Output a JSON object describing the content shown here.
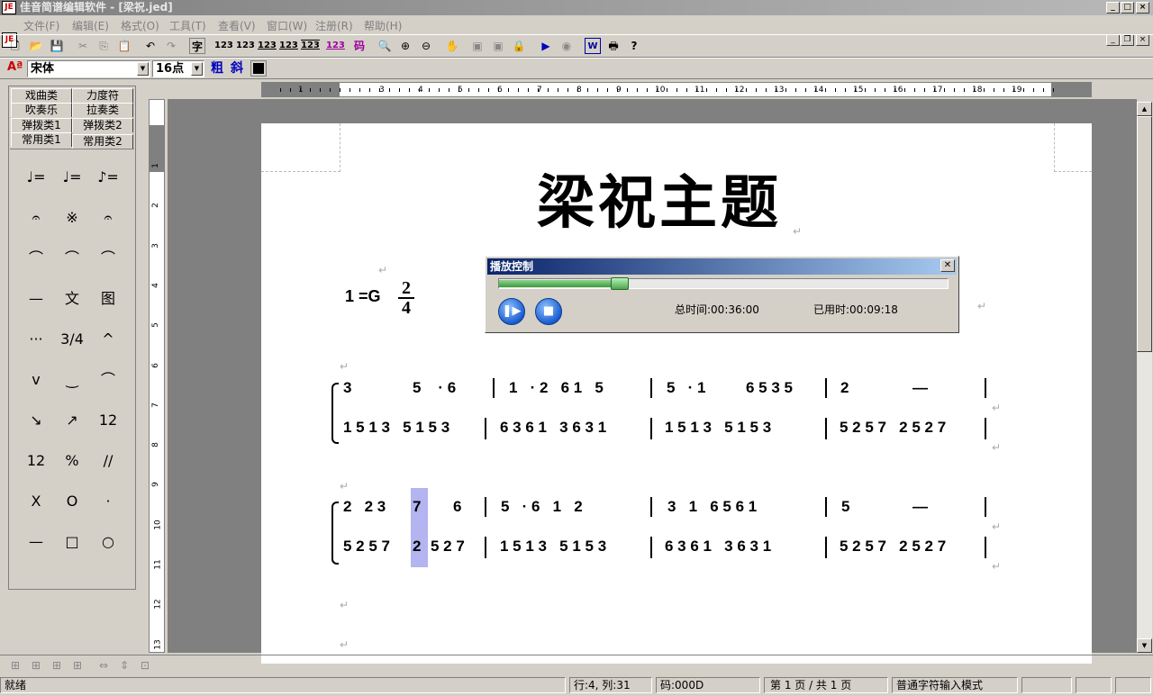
{
  "window": {
    "title": "佳音简谱编辑软件 - [梁祝.jed]",
    "app_logo": "JE"
  },
  "menu": [
    "文件(F)",
    "编辑(E)",
    "格式(O)",
    "工具(T)",
    "查看(V)",
    "窗口(W)",
    "注册(R)",
    "帮助(H)"
  ],
  "toolbar": {
    "text_label": "字",
    "num_labels": [
      "123",
      "123",
      "123",
      "123",
      "123",
      "123"
    ],
    "code_label": "码",
    "help_label": "?"
  },
  "format": {
    "font_value": "宋体",
    "size_value": "16点",
    "bold_label": "粗",
    "italic_label": "斜",
    "color": "#000000"
  },
  "palette_tabs": [
    [
      "戏曲类",
      "力度符"
    ],
    [
      "吹奏乐",
      "拉奏类"
    ],
    [
      "弹拨类1",
      "弹拨类2"
    ],
    [
      "常用类1",
      "常用类2"
    ]
  ],
  "palette_symbols": [
    "♩=",
    "♩=",
    "♪=",
    "𝄐",
    "※",
    "𝄐",
    "⌒",
    "⌒",
    "⌒",
    "—",
    "文",
    "图",
    "···",
    "3/4",
    "^",
    "v",
    "‿",
    "⌒",
    "↘",
    "↗",
    "12",
    "12",
    "%",
    "//",
    "X",
    "O",
    "·",
    "—",
    "□",
    "○"
  ],
  "hruler": [
    "1",
    "3",
    "4",
    "5",
    "6",
    "7",
    "8",
    "9",
    "10",
    "11",
    "12",
    "13",
    "14",
    "15",
    "16",
    "17",
    "18",
    "19"
  ],
  "vruler": [
    "1",
    "2",
    "3",
    "4",
    "5",
    "6",
    "7",
    "8",
    "9",
    "10",
    "11",
    "12",
    "13"
  ],
  "score": {
    "title": "梁祝主题",
    "key": "1 =G",
    "time_num": "2",
    "time_den": "4",
    "system1": {
      "upper": [
        "5    · 6",
        "1   · 2   6 1   5",
        "5   · 1",
        "6 5 3 5",
        "2",
        "—"
      ],
      "lower": [
        "1 5 1 3   5 1 5 3",
        "6 3 6 1   3 6 3 1",
        "1 5 1 3   5 1 5 3",
        "5 2 5 7   2 5 2 7"
      ]
    },
    "system2": {
      "upper": [
        "2   2 3",
        "7",
        "6",
        "5   · 6   1   2",
        "3   1   6 5 6 1",
        "5",
        "—"
      ],
      "lower": [
        "5 2 5 7",
        "2",
        "5 2 7",
        "1 5 1 3   5 1 5 3",
        "6 3 6 1   3 6 3 1",
        "5 2 5 7   2 5 2 7"
      ]
    },
    "upper_first": "3"
  },
  "player": {
    "title": "播放控制",
    "total_label": "总时间:00:36:00",
    "used_label": "已用时:00:09:18",
    "progress": 0.27
  },
  "status": {
    "ready": "就绪",
    "pos": "行:4, 列:31",
    "code": "码:000D",
    "page": "第 1 页 / 共 1 页",
    "mode": "普通字符输入模式"
  }
}
